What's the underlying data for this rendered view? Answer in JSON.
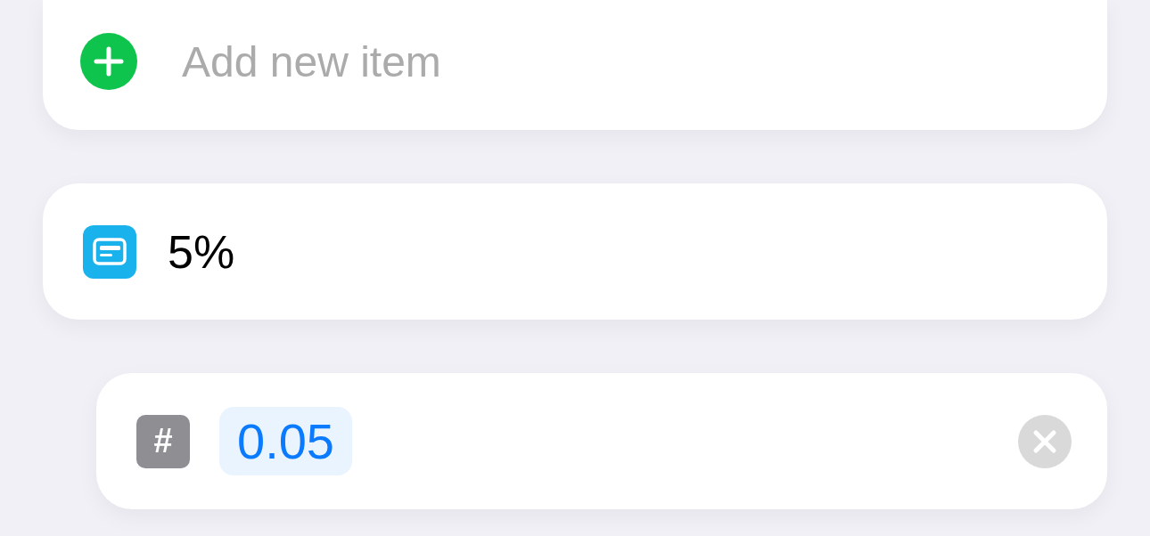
{
  "add_item": {
    "placeholder": "Add new item"
  },
  "variable": {
    "label": "5%"
  },
  "number_field": {
    "type_symbol": "#",
    "value": "0.05"
  }
}
